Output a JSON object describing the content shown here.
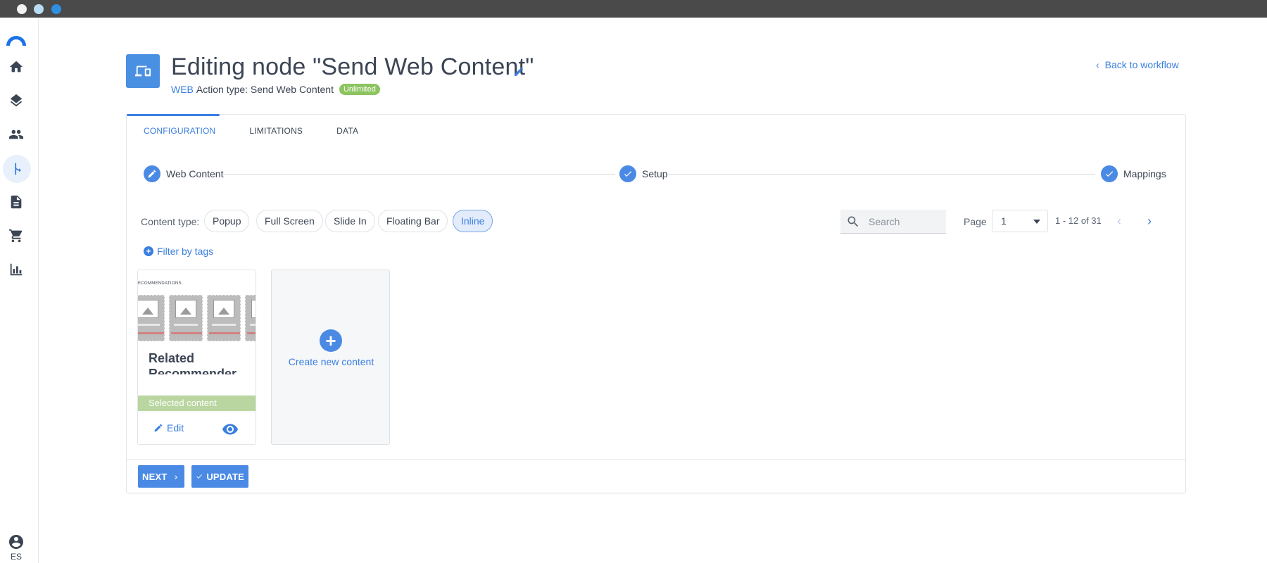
{
  "window": {
    "controls": [
      "close",
      "minimize",
      "maximize"
    ]
  },
  "sidebar": {
    "logo": "brand-logo",
    "items": [
      {
        "icon": "home-icon",
        "active": false
      },
      {
        "icon": "layers-icon",
        "active": false
      },
      {
        "icon": "people-icon",
        "active": false
      },
      {
        "icon": "workflow-icon",
        "active": true
      },
      {
        "icon": "document-icon",
        "active": false
      },
      {
        "icon": "cart-icon",
        "active": false
      },
      {
        "icon": "bar-chart-icon",
        "active": false
      }
    ],
    "user_initials": "ES"
  },
  "header": {
    "title": "Editing node \"Send Web Content\"",
    "channel": "WEB",
    "action_type": "Action type: Send Web Content",
    "badge": "Unlimited",
    "back_link": "Back to workflow"
  },
  "tabs": [
    {
      "label": "CONFIGURATION",
      "active": true
    },
    {
      "label": "LIMITATIONS",
      "active": false
    },
    {
      "label": "DATA",
      "active": false
    }
  ],
  "stepper": {
    "steps": [
      {
        "label": "Web Content",
        "state": "editing"
      },
      {
        "label": "Setup",
        "state": "done"
      },
      {
        "label": "Mappings",
        "state": "done"
      }
    ]
  },
  "filters": {
    "content_type_label": "Content type:",
    "chips": [
      {
        "label": "Popup",
        "active": false
      },
      {
        "label": "Full Screen",
        "active": false
      },
      {
        "label": "Slide In",
        "active": false
      },
      {
        "label": "Floating Bar",
        "active": false
      },
      {
        "label": "Inline",
        "active": true
      }
    ],
    "search_placeholder": "Search",
    "page_label": "Page",
    "page_value": "1",
    "range_text": "1 - 12 of 31",
    "filter_by_tags": "Filter by tags"
  },
  "tiles": [
    {
      "preview_header": "ECOMMENDATIONS",
      "title": "Related Recommender",
      "status": "Selected content",
      "edit_label": "Edit"
    }
  ],
  "create_tile": {
    "label": "Create new content"
  },
  "footer": {
    "next_label": "NEXT",
    "update_label": "UPDATE"
  },
  "colors": {
    "accent": "#3a7fe0",
    "badge_green": "#8cc460",
    "selected_green": "#b9d6a0"
  }
}
